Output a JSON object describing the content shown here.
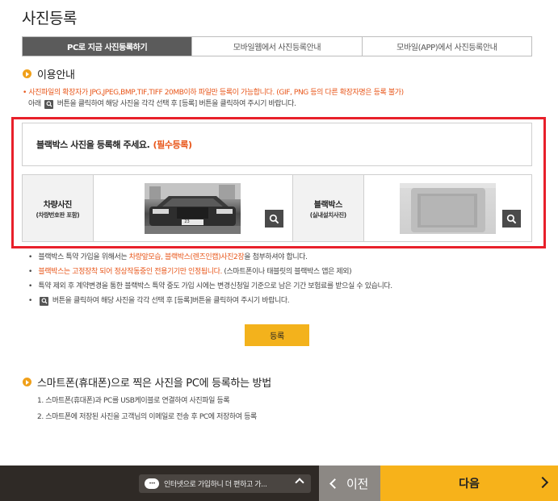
{
  "page_title": "사진등록",
  "tabs": [
    {
      "label": "PC로 지금 사진등록하기",
      "active": true
    },
    {
      "label": "모바일웹에서 사진등록안내",
      "active": false
    },
    {
      "label": "모바일(APP)에서 사진등록안내",
      "active": false
    }
  ],
  "usage": {
    "heading": "이용안내",
    "line1": "사진파일의 확장자가 JPG,JPEG,BMP,TIF,TIFF 20MB이하 파일만 등록이 가능합니다. (GIF, PNG 등의 다른 확장자명은 등록 불가)",
    "line2_pre": "아래",
    "line2_post": "버튼을 클릭하여 해당 사진을 각각 선택 후 [등록] 버튼을 클릭하여 주시기 바랍니다."
  },
  "blackbox_box": {
    "text": "블랙박스 사진을 등록해 주세요.",
    "required": "(필수등록)"
  },
  "upload": {
    "vehicle_label": "차량사진",
    "vehicle_sub": "(차량번호판 포함)",
    "blackbox_label": "블랙박스",
    "blackbox_sub": "(실내설치사진)",
    "plate_text": "23"
  },
  "rules": {
    "r1_pre": "블랙박스 특약 가입을 위해서는 ",
    "r1_orange": "차량앞모습, 블랙박스(렌즈인캡)사진2장",
    "r1_post": "을 첨부하셔야 합니다.",
    "r2_orange": "블랙박스는 고정장착 되어 정상작동중인 전용기기만 인정됩니다.",
    "r2_post": " (스마트폰이나 태블릿의 블랙박스 앱은 제외)",
    "r3": "특약 제외 후 계약변경을 통한 블랙박스 특약 중도 가입 시에는 변경신청일 기준으로 남은 기간 보험료를 받으실 수 있습니다.",
    "r4_post": "버튼을 클릭하여 해당 사진을 각각 선택 후 [등록]버튼을 클릭하여 주시기 바랍니다."
  },
  "register_label": "등록",
  "smartphone": {
    "heading": "스마트폰(휴대폰)으로 찍은 사진을 PC에 등록하는 방법",
    "step1": "1. 스마트폰(휴대폰)과 PC를 USB케이블로 연결하여 사진파일 등록",
    "step2": "2. 스마트폰에 저장된 사진을 고객님의 이메일로 전송 후 PC에 저장하여 등록"
  },
  "bottom": {
    "chat_text": "인터넷으로 가입하니 더 편하고 가...",
    "prev_label": "이전",
    "next_label": "다음"
  },
  "colors": {
    "accent": "#f7b21a",
    "highlight_text": "#e8561a",
    "frame": "#e8202a",
    "active_tab": "#5b5b5b"
  }
}
